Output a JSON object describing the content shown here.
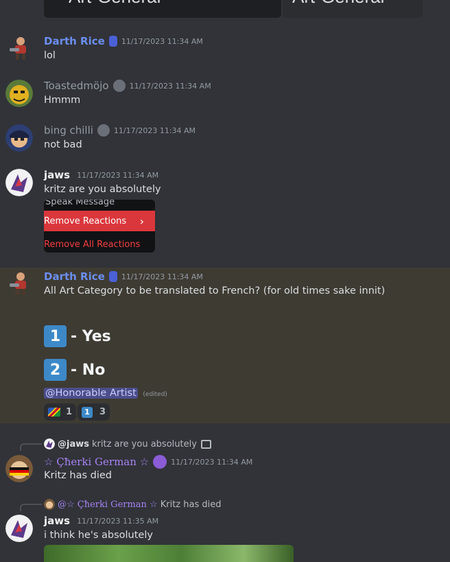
{
  "top_banner": {
    "left_title": "Art-General",
    "right_title": "Art-General",
    "close_glyph": "×"
  },
  "messages": [
    {
      "author": "Darth Rice",
      "author_color": "#6c8ef0",
      "timestamp": "11/17/2023 11:34 AM",
      "text": "lol"
    },
    {
      "author": "Toastedmöjo",
      "author_color": "#949ba4",
      "timestamp": "11/17/2023 11:34 AM",
      "text": "Hmmm"
    },
    {
      "author": "bing chilli",
      "author_color": "#949ba4",
      "timestamp": "11/17/2023 11:34 AM",
      "text": "not bad"
    },
    {
      "author": "jaws",
      "author_color": "#f2f3f5",
      "timestamp": "11/17/2023 11:34 AM",
      "text": "kritz are you absolutely"
    }
  ],
  "context_menu": {
    "item_partial": "Speak Message",
    "item_remove_reactions": "Remove Reactions",
    "item_remove_all": "Remove All Reactions",
    "chevron": "›"
  },
  "poll_message": {
    "author": "Darth Rice",
    "timestamp": "11/17/2023 11:34 AM",
    "text": "All Art Category to be translated to French? (for old times sake innit)",
    "option1_num": "1",
    "option1_label": "- Yes",
    "option2_num": "2",
    "option2_label": "- No",
    "mention": "@Honorable Artist",
    "edited": "(edited)",
    "reactions": [
      {
        "emoji": "flag-namibia",
        "count": "1"
      },
      {
        "emoji": "keycap-1",
        "count": "3"
      }
    ]
  },
  "reply1": {
    "ref_author": "@jaws",
    "ref_text": "kritz are you absolutely",
    "author": "☆ Çħerki German ☆",
    "timestamp": "11/17/2023 11:34 AM",
    "text": "Kritz has died"
  },
  "reply2": {
    "ref_author": "@☆ Çħerki German ☆",
    "ref_text": "Kritz has died",
    "author": "jaws",
    "timestamp": "11/17/2023 11:35 AM",
    "text": "i think he's absolutely"
  },
  "colors": {
    "background": "#313338",
    "highlight": "#3e3b33",
    "mention": "#c9cdfb",
    "danger": "#da373c",
    "keycap": "#3d89c8",
    "purple_name": "#a782f5"
  }
}
